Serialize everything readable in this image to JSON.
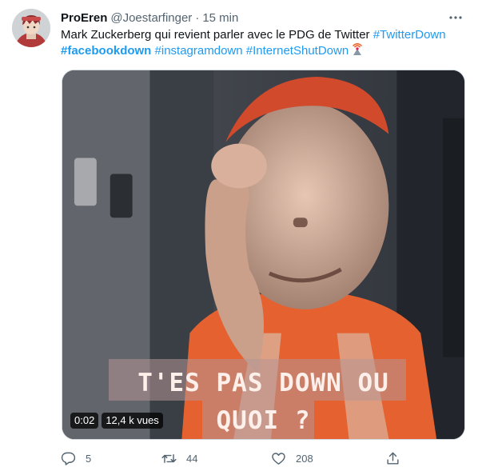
{
  "tweet": {
    "author_name": "ProEren",
    "author_handle": "@Joestarfinger",
    "separator": "·",
    "time": "15 min",
    "text_intro": "Mark Zuckerberg qui revient parler avec le PDG de Twitter ",
    "hashtags": {
      "twitterdown": "#TwitterDown",
      "facebookdown": "#facebookdown",
      "instagramdown": "#instagramdown",
      "internetshutdown": "#InternetShutDown"
    },
    "emoji": "satellite-antenna-emoji"
  },
  "media": {
    "caption_line1": "T'ES PAS DOWN OU",
    "caption_line2": "QUOI ?",
    "duration": "0:02",
    "views": "12,4 k vues"
  },
  "actions": {
    "replies": "5",
    "retweets": "44",
    "likes": "208"
  },
  "icons": {
    "more": "more-dots-icon",
    "reply": "reply-icon",
    "retweet": "retweet-icon",
    "like": "heart-icon",
    "share": "share-icon"
  },
  "colors": {
    "accent": "#1d9bf0",
    "secondary_text": "#536471",
    "primary_text": "#0f1419"
  }
}
